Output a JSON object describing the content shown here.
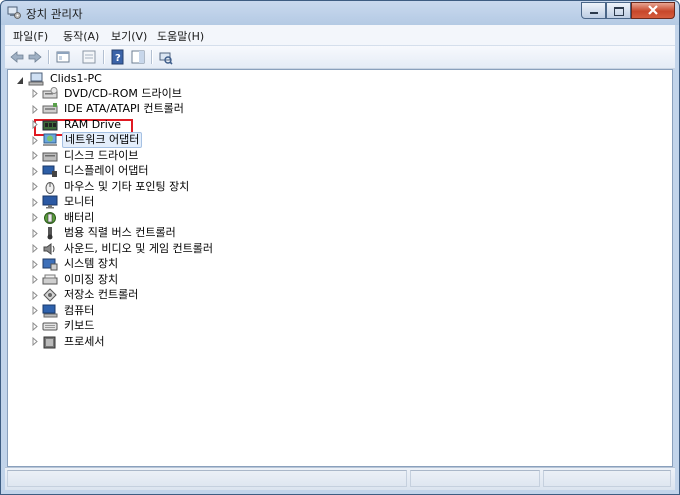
{
  "window": {
    "title": "장치 관리자"
  },
  "menu": [
    "파일(F)",
    "동작(A)",
    "보기(V)",
    "도움말(H)"
  ],
  "toolbar": [
    "back-icon",
    "forward-icon",
    "properties-view-icon",
    "show-hide-icon",
    "help-icon",
    "action-pane-icon",
    "scan-hardware-icon"
  ],
  "tree": {
    "root": "Clids1-PC",
    "items": [
      {
        "label": "DVD/CD-ROM 드라이브",
        "icon": "dvd-drive-icon"
      },
      {
        "label": "IDE ATA/ATAPI 컨트롤러",
        "icon": "ide-controller-icon"
      },
      {
        "label": "RAM Drive",
        "icon": "ram-drive-icon",
        "highlighted": true
      },
      {
        "label": "네트워크 어댑터",
        "icon": "network-adapter-icon",
        "selected": true
      },
      {
        "label": "디스크 드라이브",
        "icon": "disk-drive-icon"
      },
      {
        "label": "디스플레이 어댑터",
        "icon": "display-adapter-icon"
      },
      {
        "label": "마우스 및 기타 포인팅 장치",
        "icon": "mouse-icon"
      },
      {
        "label": "모니터",
        "icon": "monitor-icon"
      },
      {
        "label": "배터리",
        "icon": "battery-icon"
      },
      {
        "label": "범용 직렬 버스 컨트롤러",
        "icon": "usb-controller-icon"
      },
      {
        "label": "사운드, 비디오 및 게임 컨트롤러",
        "icon": "sound-icon"
      },
      {
        "label": "시스템 장치",
        "icon": "system-device-icon"
      },
      {
        "label": "이미징 장치",
        "icon": "imaging-device-icon"
      },
      {
        "label": "저장소 컨트롤러",
        "icon": "storage-controller-icon"
      },
      {
        "label": "컴퓨터",
        "icon": "computer-icon"
      },
      {
        "label": "키보드",
        "icon": "keyboard-icon"
      },
      {
        "label": "프로세서",
        "icon": "processor-icon"
      }
    ]
  },
  "colors": {
    "highlight_border": "#e01a22",
    "selection_bg": "#e4eefb"
  }
}
